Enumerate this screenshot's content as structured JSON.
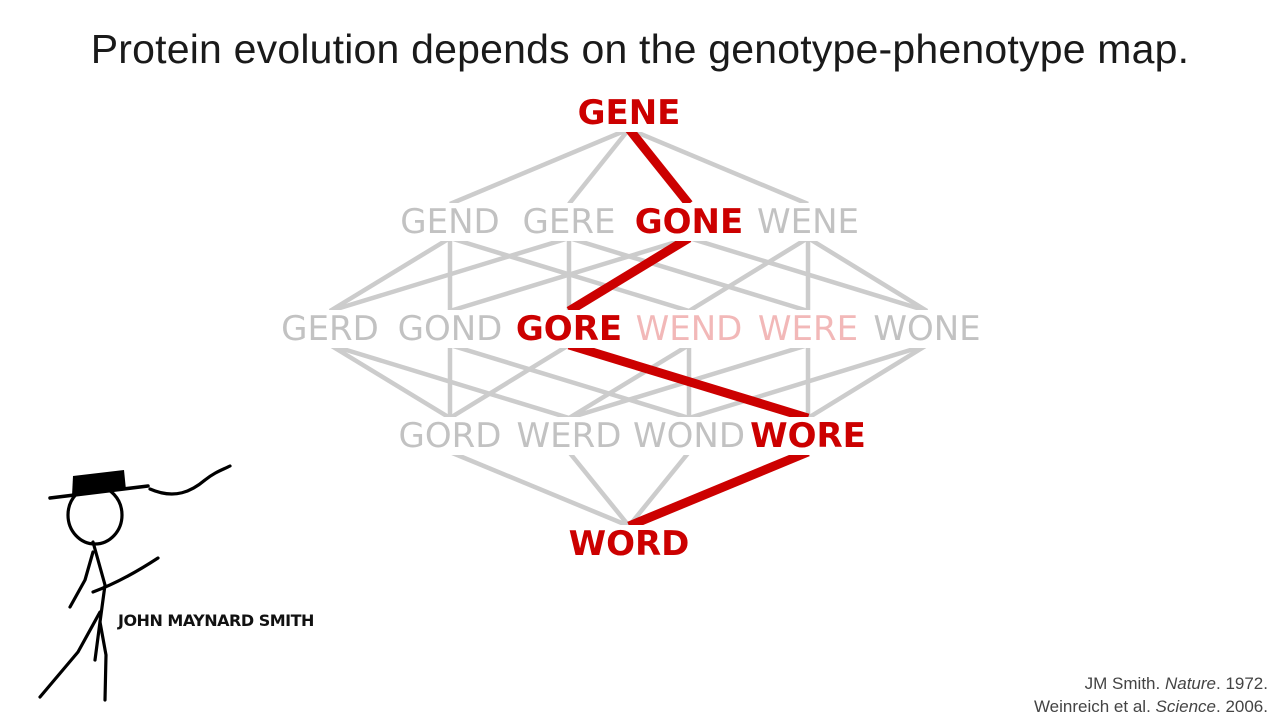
{
  "slide": {
    "title": "Protein evolution depends on the genotype-phenotype map.",
    "caption": "JOHN MAYNARD SMITH",
    "references": [
      {
        "author": "JM Smith. ",
        "journal": "Nature",
        "year": ". 1972."
      },
      {
        "author": "Weinreich et al. ",
        "journal": "Science",
        "year": ". 2006."
      }
    ]
  },
  "colors": {
    "edge_default": "#cccccc",
    "edge_path": "#cc0000",
    "word_default": "#c2c2c2",
    "word_path": "#cc0000",
    "word_light": "#f2b8b8"
  },
  "lattice": {
    "nodes": [
      {
        "id": "GENE",
        "label": "GENE",
        "state": "path"
      },
      {
        "id": "GEND",
        "label": "GEND",
        "state": "default"
      },
      {
        "id": "GERE",
        "label": "GERE",
        "state": "default"
      },
      {
        "id": "GONE",
        "label": "GONE",
        "state": "path"
      },
      {
        "id": "WENE",
        "label": "WENE",
        "state": "default"
      },
      {
        "id": "GERD",
        "label": "GERD",
        "state": "default"
      },
      {
        "id": "GOND",
        "label": "GOND",
        "state": "default"
      },
      {
        "id": "GORE",
        "label": "GORE",
        "state": "path"
      },
      {
        "id": "WEND",
        "label": "WEND",
        "state": "light"
      },
      {
        "id": "WERE",
        "label": "WERE",
        "state": "light"
      },
      {
        "id": "WONE",
        "label": "WONE",
        "state": "default"
      },
      {
        "id": "GORD",
        "label": "GORD",
        "state": "default"
      },
      {
        "id": "WERD",
        "label": "WERD",
        "state": "default"
      },
      {
        "id": "WOND",
        "label": "WOND",
        "state": "default"
      },
      {
        "id": "WORE",
        "label": "WORE",
        "state": "path"
      },
      {
        "id": "WORD",
        "label": "WORD",
        "state": "path"
      }
    ],
    "path": [
      "GENE",
      "GONE",
      "GORE",
      "WORE",
      "WORD"
    ]
  }
}
